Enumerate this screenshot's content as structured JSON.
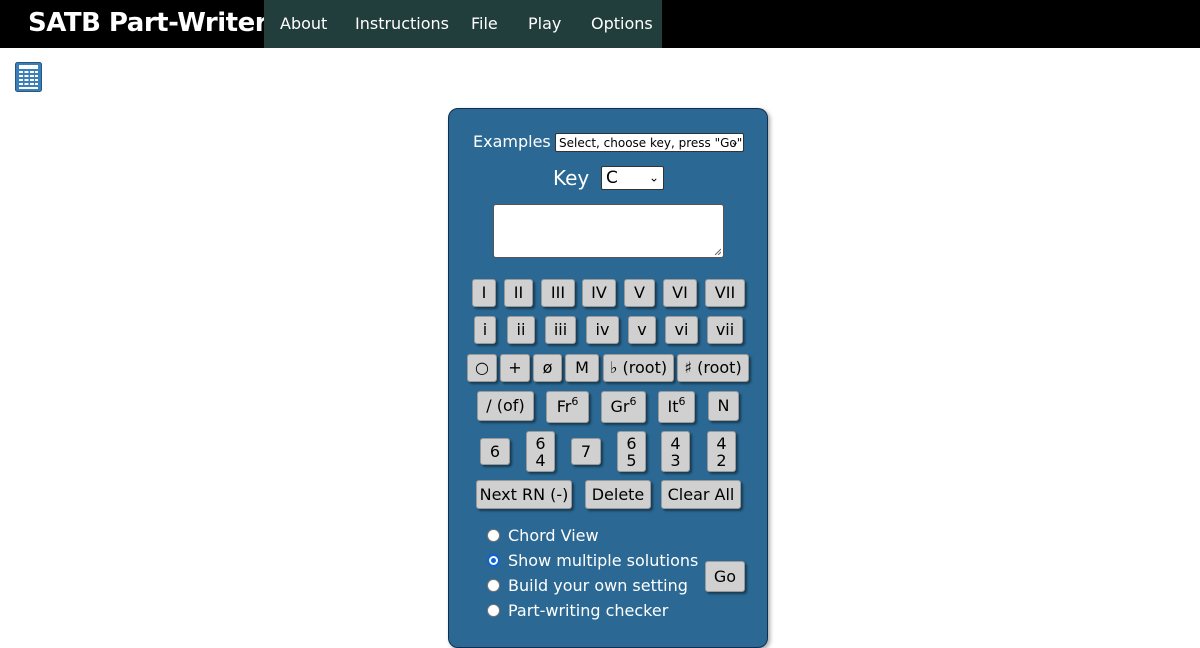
{
  "header": {
    "brand": "SATB Part-Writer",
    "nav": [
      {
        "label": "About"
      },
      {
        "label": "Instructions"
      },
      {
        "label": "File"
      },
      {
        "label": "Play"
      },
      {
        "label": "Options"
      }
    ]
  },
  "panel": {
    "examples_label": "Examples",
    "examples_select": "Select, choose key, press \"Go\"",
    "key_label": "Key",
    "key_select": "C",
    "rn_input": "",
    "upper_numerals": [
      "I",
      "II",
      "III",
      "IV",
      "V",
      "VI",
      "VII"
    ],
    "lower_numerals": [
      "i",
      "ii",
      "iii",
      "iv",
      "v",
      "vi",
      "vii"
    ],
    "qualities": [
      "○",
      "+",
      "ø",
      "M",
      "♭ (root)",
      "♯ (root)"
    ],
    "special": {
      "of": "/ (of)",
      "fr": "Fr",
      "fr_sup": "6",
      "gr": "Gr",
      "gr_sup": "6",
      "it": "It",
      "it_sup": "6",
      "n": "N"
    },
    "inversions": {
      "six": "6",
      "six_four_top": "6",
      "six_four_bottom": "4",
      "seven": "7",
      "six_five_top": "6",
      "six_five_bottom": "5",
      "four_three_top": "4",
      "four_three_bottom": "3",
      "four_two_top": "4",
      "four_two_bottom": "2"
    },
    "actions": {
      "next": "Next RN (-)",
      "delete": "Delete",
      "clear": "Clear All"
    },
    "modes": [
      {
        "label": "Chord View",
        "checked": false
      },
      {
        "label": "Show multiple solutions",
        "checked": true
      },
      {
        "label": "Build your own setting",
        "checked": false
      },
      {
        "label": "Part-writing checker",
        "checked": false
      }
    ],
    "go": "Go"
  },
  "colors": {
    "panel": "#2b6994",
    "nav": "#213d3c",
    "radio_accent": "#0b64d6"
  }
}
